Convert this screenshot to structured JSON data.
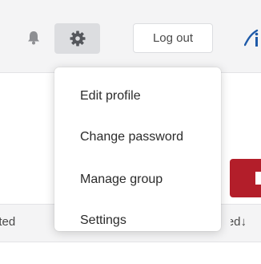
{
  "header": {
    "logout_label": "Log out",
    "icons": {
      "notifications": "bell-icon",
      "settings": "gear-icon",
      "brand": "brand-logo-icon"
    },
    "colors": {
      "bar_bg": "#f4f4f5",
      "gear_bg": "#dcdde0"
    }
  },
  "settings_menu": {
    "items": [
      {
        "label": "Edit profile"
      },
      {
        "label": "Change password"
      },
      {
        "label": "Manage group"
      },
      {
        "label": "Settings"
      }
    ]
  },
  "action": {
    "button_color": "#b31e2a"
  },
  "table": {
    "columns": {
      "left": "ated",
      "right": "lated↓"
    }
  }
}
